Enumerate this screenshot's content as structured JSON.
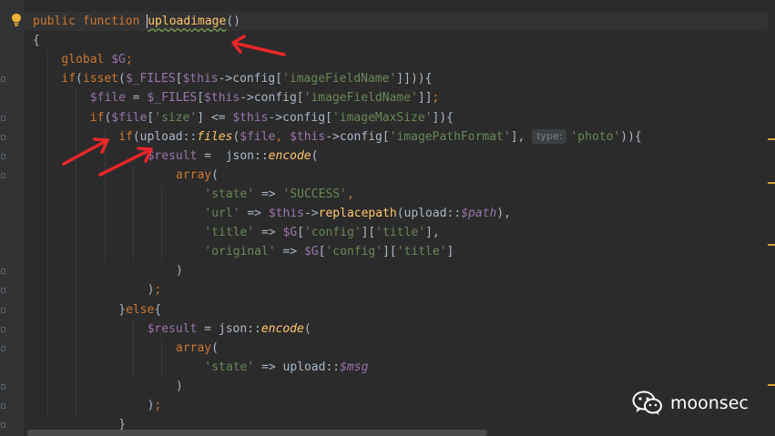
{
  "editor": {
    "lines": [
      {
        "t": [
          {
            "v": "public function ",
            "c": "kw"
          },
          {
            "v": "upload",
            "c": "fn wavy cur"
          },
          {
            "v": "image",
            "c": "fn wavy"
          },
          {
            "v": "()",
            "c": "pl"
          }
        ]
      },
      {
        "t": [
          {
            "v": "{",
            "c": "pl"
          }
        ]
      },
      {
        "t": [
          {
            "v": "global ",
            "c": "kw"
          },
          {
            "v": "$G",
            "c": "var"
          },
          {
            "v": ";",
            "c": "kw"
          }
        ]
      },
      {
        "t": [
          {
            "v": "if",
            "c": "kw"
          },
          {
            "v": "(",
            "c": "pl"
          },
          {
            "v": "isset",
            "c": "kw"
          },
          {
            "v": "(",
            "c": "pl"
          },
          {
            "v": "$_FILES",
            "c": "var"
          },
          {
            "v": "[",
            "c": "pl"
          },
          {
            "v": "$this",
            "c": "var"
          },
          {
            "v": "->config[",
            "c": "pl"
          },
          {
            "v": "'imageFieldName'",
            "c": "str"
          },
          {
            "v": "]])){",
            "c": "pl"
          }
        ]
      },
      {
        "t": [
          {
            "v": "$file",
            "c": "var"
          },
          {
            "v": " = ",
            "c": "pl"
          },
          {
            "v": "$_FILES",
            "c": "var"
          },
          {
            "v": "[",
            "c": "pl"
          },
          {
            "v": "$this",
            "c": "var"
          },
          {
            "v": "->config[",
            "c": "pl"
          },
          {
            "v": "'imageFieldName'",
            "c": "str"
          },
          {
            "v": "]]",
            "c": "pl"
          },
          {
            "v": ";",
            "c": "kw"
          }
        ]
      },
      {
        "t": [
          {
            "v": "if",
            "c": "kw"
          },
          {
            "v": "(",
            "c": "pl"
          },
          {
            "v": "$file",
            "c": "var"
          },
          {
            "v": "[",
            "c": "pl"
          },
          {
            "v": "'size'",
            "c": "str"
          },
          {
            "v": "] <= ",
            "c": "pl"
          },
          {
            "v": "$this",
            "c": "var"
          },
          {
            "v": "->config[",
            "c": "pl"
          },
          {
            "v": "'imageMaxSize'",
            "c": "str"
          },
          {
            "v": "]){",
            "c": "pl"
          }
        ]
      },
      {
        "t": [
          {
            "v": "if",
            "c": "kw"
          },
          {
            "v": "(upload::",
            "c": "pl"
          },
          {
            "v": "files",
            "c": "fn it"
          },
          {
            "v": "(",
            "c": "pl"
          },
          {
            "v": "$file",
            "c": "var"
          },
          {
            "v": ", ",
            "c": "kw"
          },
          {
            "v": "$this",
            "c": "var"
          },
          {
            "v": "->config[",
            "c": "pl"
          },
          {
            "v": "'imagePathFormat'",
            "c": "str"
          },
          {
            "v": "], ",
            "c": "pl"
          },
          {
            "v": "type:",
            "c": "hint"
          },
          {
            "v": "'photo'",
            "c": "str"
          },
          {
            "v": ")){",
            "c": "pl"
          }
        ]
      },
      {
        "t": [
          {
            "v": "$result",
            "c": "var"
          },
          {
            "v": " =  json::",
            "c": "pl"
          },
          {
            "v": "encode",
            "c": "fn it"
          },
          {
            "v": "(",
            "c": "pl"
          }
        ]
      },
      {
        "t": [
          {
            "v": "array",
            "c": "kw"
          },
          {
            "v": "(",
            "c": "pl"
          }
        ]
      },
      {
        "t": [
          {
            "v": "'state'",
            "c": "str"
          },
          {
            "v": " => ",
            "c": "pl"
          },
          {
            "v": "'SUCCESS'",
            "c": "str"
          },
          {
            "v": ",",
            "c": "kw"
          }
        ]
      },
      {
        "t": [
          {
            "v": "'url'",
            "c": "str"
          },
          {
            "v": " => ",
            "c": "pl"
          },
          {
            "v": "$this",
            "c": "var"
          },
          {
            "v": "->",
            "c": "pl"
          },
          {
            "v": "replacepath",
            "c": "fn"
          },
          {
            "v": "(upload::",
            "c": "pl"
          },
          {
            "v": "$path",
            "c": "var it"
          },
          {
            "v": "),",
            "c": "pl"
          }
        ]
      },
      {
        "t": [
          {
            "v": "'title'",
            "c": "str"
          },
          {
            "v": " => ",
            "c": "pl"
          },
          {
            "v": "$G",
            "c": "var"
          },
          {
            "v": "[",
            "c": "pl"
          },
          {
            "v": "'config'",
            "c": "str"
          },
          {
            "v": "][",
            "c": "pl"
          },
          {
            "v": "'title'",
            "c": "str"
          },
          {
            "v": "],",
            "c": "pl"
          }
        ]
      },
      {
        "t": [
          {
            "v": "'original'",
            "c": "str"
          },
          {
            "v": " => ",
            "c": "pl"
          },
          {
            "v": "$G",
            "c": "var"
          },
          {
            "v": "[",
            "c": "pl"
          },
          {
            "v": "'config'",
            "c": "str"
          },
          {
            "v": "][",
            "c": "pl"
          },
          {
            "v": "'title'",
            "c": "str"
          },
          {
            "v": "]",
            "c": "pl"
          }
        ]
      },
      {
        "t": [
          {
            "v": ")",
            "c": "pl"
          }
        ]
      },
      {
        "t": [
          {
            "v": ")",
            "c": "pl"
          },
          {
            "v": ";",
            "c": "kw"
          }
        ]
      },
      {
        "t": [
          {
            "v": "}",
            "c": "pl"
          },
          {
            "v": "else",
            "c": "kw"
          },
          {
            "v": "{",
            "c": "pl"
          }
        ]
      },
      {
        "t": [
          {
            "v": "$result",
            "c": "var"
          },
          {
            "v": " = json::",
            "c": "pl"
          },
          {
            "v": "encode",
            "c": "fn it"
          },
          {
            "v": "(",
            "c": "pl"
          }
        ]
      },
      {
        "t": [
          {
            "v": "array",
            "c": "kw"
          },
          {
            "v": "(",
            "c": "pl"
          }
        ]
      },
      {
        "t": [
          {
            "v": "'state'",
            "c": "str"
          },
          {
            "v": " => upload::",
            "c": "pl"
          },
          {
            "v": "$msg",
            "c": "var it"
          }
        ]
      },
      {
        "t": [
          {
            "v": ")",
            "c": "pl"
          }
        ]
      },
      {
        "t": [
          {
            "v": ")",
            "c": "pl"
          },
          {
            "v": ";",
            "c": "kw"
          }
        ]
      },
      {
        "t": [
          {
            "v": "}",
            "c": "pl"
          }
        ]
      }
    ]
  },
  "icons": {
    "bulb": "lightbulb-icon",
    "watermark": "wechat-icon"
  },
  "watermark": {
    "text": "moonsec"
  },
  "colors": {
    "background": "#2b2b2b",
    "keyword": "#cc7832",
    "variable": "#9876aa",
    "function": "#ffc66d",
    "string": "#6a8759",
    "plain": "#a9b7c6",
    "annotation_arrow": "#e8262b"
  }
}
